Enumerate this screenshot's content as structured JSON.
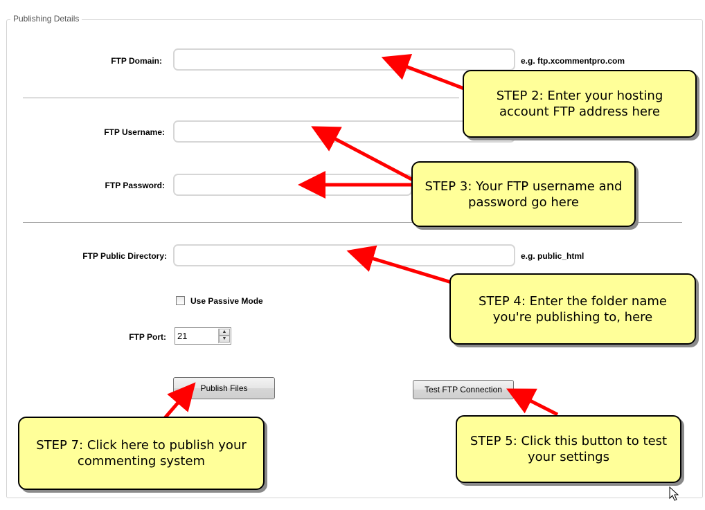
{
  "group": {
    "title": "Publishing Details"
  },
  "fields": {
    "ftp_domain": {
      "label": "FTP Domain:",
      "value": "",
      "hint": "e.g. ftp.xcommentpro.com"
    },
    "ftp_username": {
      "label": "FTP Username:",
      "value": ""
    },
    "ftp_password": {
      "label": "FTP Password:",
      "value": ""
    },
    "ftp_public_directory": {
      "label": "FTP Public Directory:",
      "value": "",
      "hint": "e.g. public_html"
    },
    "passive_mode": {
      "label": "Use Passive Mode",
      "checked": false
    },
    "ftp_port": {
      "label": "FTP Port:",
      "value": "21"
    }
  },
  "buttons": {
    "publish": "Publish Files",
    "test": "Test FTP Connection"
  },
  "callouts": {
    "step2": "STEP 2: Enter your hosting account FTP address here",
    "step3": "STEP 3: Your FTP username and password go here",
    "step4": "STEP 4: Enter the folder name you're publishing to, here",
    "step5": "STEP 5: Click this button to test your settings",
    "step7": "STEP 7: Click here to publish your commenting system"
  },
  "colors": {
    "callout_bg": "#ffff99",
    "arrow": "#ff0000"
  }
}
